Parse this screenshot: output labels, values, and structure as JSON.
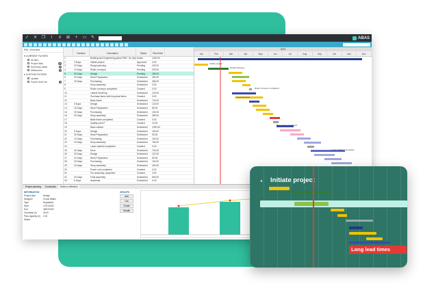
{
  "titlebar": {
    "icons": [
      "check-icon",
      "close-icon",
      "copy-icon",
      "info-icon",
      "list-icon",
      "cart-icon",
      "add-icon",
      "file-icon",
      "edit-icon"
    ],
    "search_value": "",
    "brand": "ABAS"
  },
  "left_panel": {
    "breadcrumb": "PBL: Overview",
    "groups": [
      {
        "label": "▾ CURRENT FILTERS",
        "items": [
          {
            "label": "All files",
            "count": ""
          },
          {
            "label": "Project lists",
            "count": "10"
          },
          {
            "label": "Summary tasks",
            "count": "8"
          },
          {
            "label": "Milestones",
            "count": "4"
          }
        ]
      },
      {
        "label": "▾ CUSTOM FILTERS",
        "items": [
          {
            "label": "Update",
            "count": ""
          },
          {
            "label": "Future level list",
            "count": "0"
          }
        ]
      }
    ]
  },
  "grid": {
    "columns": [
      "",
      "Duration",
      "Description",
      "Status",
      "Plan finish"
    ],
    "rows": [
      {
        "n": "1",
        "dur": "",
        "desc": "Building and Engineering plans PBS / Go (Special units)",
        "status": "Active",
        "fin": "1200.00",
        "sel": false
      },
      {
        "n": "2",
        "dur": "3 Days",
        "desc": "Initiate project",
        "status": "Approved",
        "fin": "0.00",
        "sel": false
      },
      {
        "n": "3",
        "dur": "20 Days",
        "desc": "Rough planning",
        "status": "Pending",
        "fin": "100.00",
        "sel": false
      },
      {
        "n": "4",
        "dur": "10 Days",
        "desc": "Roller conveyor",
        "status": "Pending",
        "fin": "225.00",
        "sel": false
      },
      {
        "n": "5",
        "dur": "30 Days",
        "desc": "Design",
        "status": "Pending",
        "fin": "180.00",
        "sel": true
      },
      {
        "n": "6",
        "dur": "20 Days",
        "desc": "Work Preparation",
        "status": "Scheduled",
        "fin": "250.00",
        "sel": false
      },
      {
        "n": "7",
        "dur": "20 Days",
        "desc": "Purchasing",
        "status": "Scheduled",
        "fin": "280.00",
        "sel": false
      },
      {
        "n": "8",
        "dur": "",
        "desc": "Shop assembly",
        "status": "Scheduled",
        "fin": "0.00",
        "sel": false
      },
      {
        "n": "9",
        "dur": "",
        "desc": "Roller conveyor completed",
        "status": "Created",
        "fin": "0.00",
        "sel": false
      },
      {
        "n": "10",
        "dur": "",
        "desc": "Lateral Mounting",
        "status": "Scheduled",
        "fin": "120.00",
        "sel": false
      },
      {
        "n": "11",
        "dur": "",
        "desc": "Purchase items with long lead times",
        "status": "Created",
        "fin": "0.00",
        "sel": false
      },
      {
        "n": "12",
        "dur": "",
        "desc": "Base frame",
        "status": "Scheduled",
        "fin": "720.00",
        "sel": false
      },
      {
        "n": "13",
        "dur": "5 Days",
        "desc": "Design",
        "status": "Scheduled",
        "fin": "120.00",
        "sel": false
      },
      {
        "n": "14",
        "dur": "15 Days",
        "desc": "Work Preparation",
        "status": "Scheduled",
        "fin": "80.00",
        "sel": false
      },
      {
        "n": "15",
        "dur": "30 Days",
        "desc": "Purchasing",
        "status": "Scheduled",
        "fin": "100.00",
        "sel": false
      },
      {
        "n": "16",
        "dur": "20 Days",
        "desc": "Shop assembly",
        "status": "Scheduled",
        "fin": "280.00",
        "sel": false
      },
      {
        "n": "17",
        "dur": "",
        "desc": "Base frame completed",
        "status": "Created",
        "fin": "0.00",
        "sel": false
      },
      {
        "n": "18",
        "dur": "",
        "desc": "Quality point P",
        "status": "Created",
        "fin": "10.00",
        "sel": false
      },
      {
        "n": "19",
        "dur": "",
        "desc": "Base cabinet",
        "status": "Scheduled",
        "fin": "1300.00",
        "sel": false
      },
      {
        "n": "20",
        "dur": "5 Days",
        "desc": "Design",
        "status": "Scheduled",
        "fin": "150.00",
        "sel": false
      },
      {
        "n": "21",
        "dur": "25 Days",
        "desc": "Work Preparation",
        "status": "Scheduled",
        "fin": "90.00",
        "sel": false
      },
      {
        "n": "22",
        "dur": "10 Days",
        "desc": "Purchasing",
        "status": "Scheduled",
        "fin": "100.00",
        "sel": false
      },
      {
        "n": "23",
        "dur": "20 Days",
        "desc": "Shop assembly",
        "status": "Scheduled",
        "fin": "760.00",
        "sel": false
      },
      {
        "n": "24",
        "dur": "",
        "desc": "Lower cabinet completed",
        "status": "Created",
        "fin": "0.00",
        "sel": false
      },
      {
        "n": "25",
        "dur": "40 Days",
        "desc": "Drive",
        "status": "Scheduled",
        "fin": "700.00",
        "sel": false
      },
      {
        "n": "26",
        "dur": "30 Days",
        "desc": "Design",
        "status": "Scheduled",
        "fin": "120.00",
        "sel": false
      },
      {
        "n": "27",
        "dur": "10 Days",
        "desc": "Work Preparation",
        "status": "Scheduled",
        "fin": "50.00",
        "sel": false
      },
      {
        "n": "28",
        "dur": "20 Days",
        "desc": "Purchasing",
        "status": "Scheduled",
        "fin": "100.00",
        "sel": false
      },
      {
        "n": "29",
        "dur": "15 Days",
        "desc": "Shop assembly",
        "status": "Scheduled",
        "fin": "400.00",
        "sel": false
      },
      {
        "n": "30",
        "dur": "",
        "desc": "Power unit completed",
        "status": "Created",
        "fin": "0.00",
        "sel": false
      },
      {
        "n": "31",
        "dur": "",
        "desc": "Pre-assembly completed",
        "status": "Created",
        "fin": "0.00",
        "sel": false
      },
      {
        "n": "32",
        "dur": "20 Days",
        "desc": "Final assembly",
        "status": "Scheduled",
        "fin": "600.00",
        "sel": false
      },
      {
        "n": "33",
        "dur": "5 Days",
        "desc": "Assembly",
        "status": "Scheduled",
        "fin": "0.00",
        "sel": false
      }
    ]
  },
  "gantt": {
    "year": "2022",
    "months": [
      "Jan",
      "Feb",
      "Mar",
      "Apr",
      "May",
      "Jun",
      "Jul",
      "Aug",
      "Sep",
      "Oct",
      "Nov",
      "Dec"
    ],
    "labels": {
      "initiate": "Initiate project",
      "rough": "Rough planning",
      "roller_done": "Roller conveyor completed",
      "long_lead": "Long lead times",
      "base_done": "Base frame completed",
      "lower_done": "Lower cabinet completed"
    }
  },
  "bottom": {
    "tabs": [
      "Project planning",
      "Connection",
      "Notes in reflection"
    ],
    "info_title": "INFORMATION",
    "info": [
      {
        "k": "Project plan",
        "v": "Design"
      },
      {
        "k": "Designer",
        "v": "Chuck Walter"
      },
      {
        "k": "Type",
        "v": "Regularize"
      },
      {
        "k": "Start",
        "v": "17/01/2022"
      },
      {
        "k": "End",
        "v": "28/02/2022"
      },
      {
        "k": "Overhead (h)",
        "v": "30.00"
      },
      {
        "k": "Plan capacity (h)",
        "v": "0.00"
      },
      {
        "k": "Status",
        "v": ""
      }
    ],
    "actions_title": "GROUPS",
    "actions": [
      "Add",
      "Out",
      "Create",
      "Handle"
    ]
  },
  "overlay": {
    "title": "Initiate project",
    "lead_label": "Long lead times"
  }
}
